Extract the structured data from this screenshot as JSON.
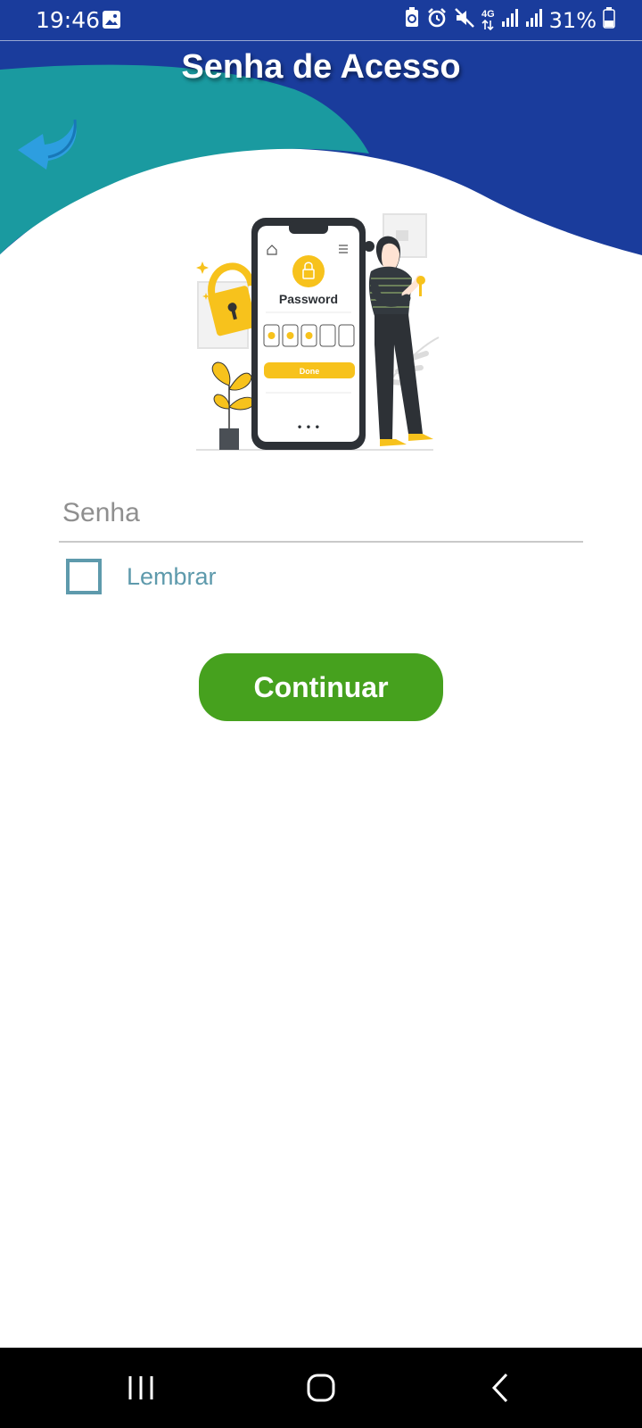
{
  "status_bar": {
    "time": "19:46",
    "battery_percent": "31%",
    "network_type": "4G",
    "icons": [
      "gallery-icon",
      "battery-saver-icon",
      "alarm-icon",
      "mute-icon",
      "data-arrows-icon",
      "signal-icon",
      "signal-icon",
      "battery-icon"
    ]
  },
  "header": {
    "title": "Senha de Acesso",
    "back_icon": "back-arrow-icon"
  },
  "illustration": {
    "phone_title": "Password",
    "done_label": "Done",
    "dots_label": "• • •"
  },
  "form": {
    "password_placeholder": "Senha",
    "password_value": "",
    "remember_label": "Lembrar",
    "remember_checked": false,
    "continue_label": "Continuar"
  },
  "nav_bar": {
    "buttons": [
      "recent-apps-icon",
      "home-icon",
      "back-icon"
    ]
  },
  "colors": {
    "header_blue": "#1a3c9c",
    "teal": "#1a9aa0",
    "accent_button": "#46a11e",
    "checkbox": "#5e9aac",
    "illustration_yellow": "#f7c21c"
  }
}
